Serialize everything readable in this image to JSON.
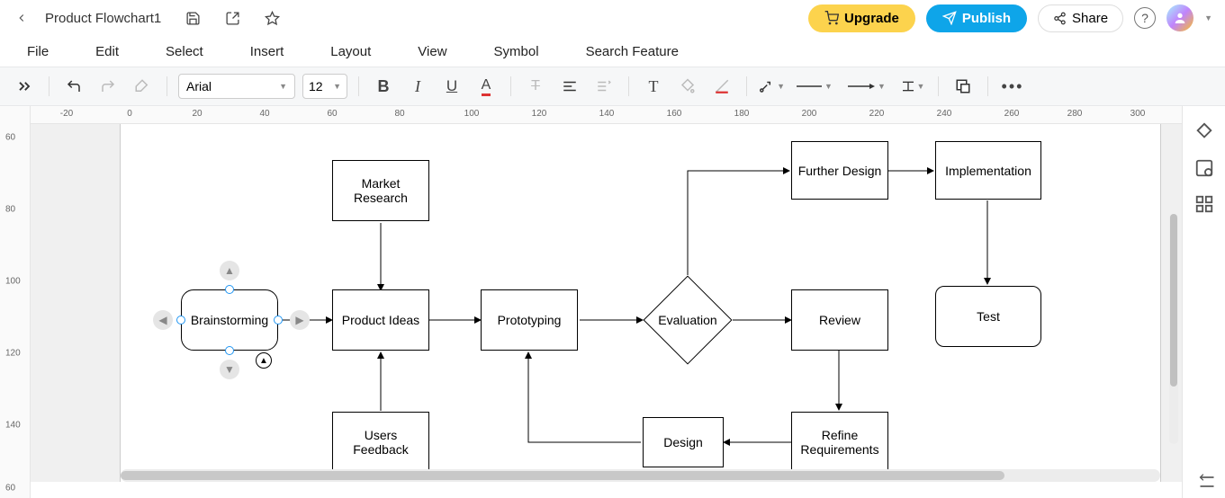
{
  "doc": {
    "title": "Product Flowchart1"
  },
  "topbar": {
    "upgrade": "Upgrade",
    "publish": "Publish",
    "share": "Share"
  },
  "menu": {
    "file": "File",
    "edit": "Edit",
    "select": "Select",
    "insert": "Insert",
    "layout": "Layout",
    "view": "View",
    "symbol": "Symbol",
    "search": "Search Feature"
  },
  "toolbar": {
    "font": "Arial",
    "size": "12"
  },
  "ruler": {
    "h": [
      "-20",
      "0",
      "20",
      "40",
      "60",
      "80",
      "100",
      "120",
      "140",
      "160",
      "180",
      "200",
      "220",
      "240",
      "260",
      "280",
      "300"
    ],
    "v": [
      "60",
      "80",
      "100",
      "120",
      "140",
      "60"
    ]
  },
  "nodes": {
    "brainstorming": "Brainstorming",
    "market": "Market Research",
    "ideas": "Product Ideas",
    "proto": "Prototyping",
    "eval": "Evaluation",
    "further": "Further Design",
    "impl": "Implementation",
    "review": "Review",
    "test": "Test",
    "refine": "Refine Requirements",
    "design": "Design",
    "feedback": "Users Feedback"
  }
}
